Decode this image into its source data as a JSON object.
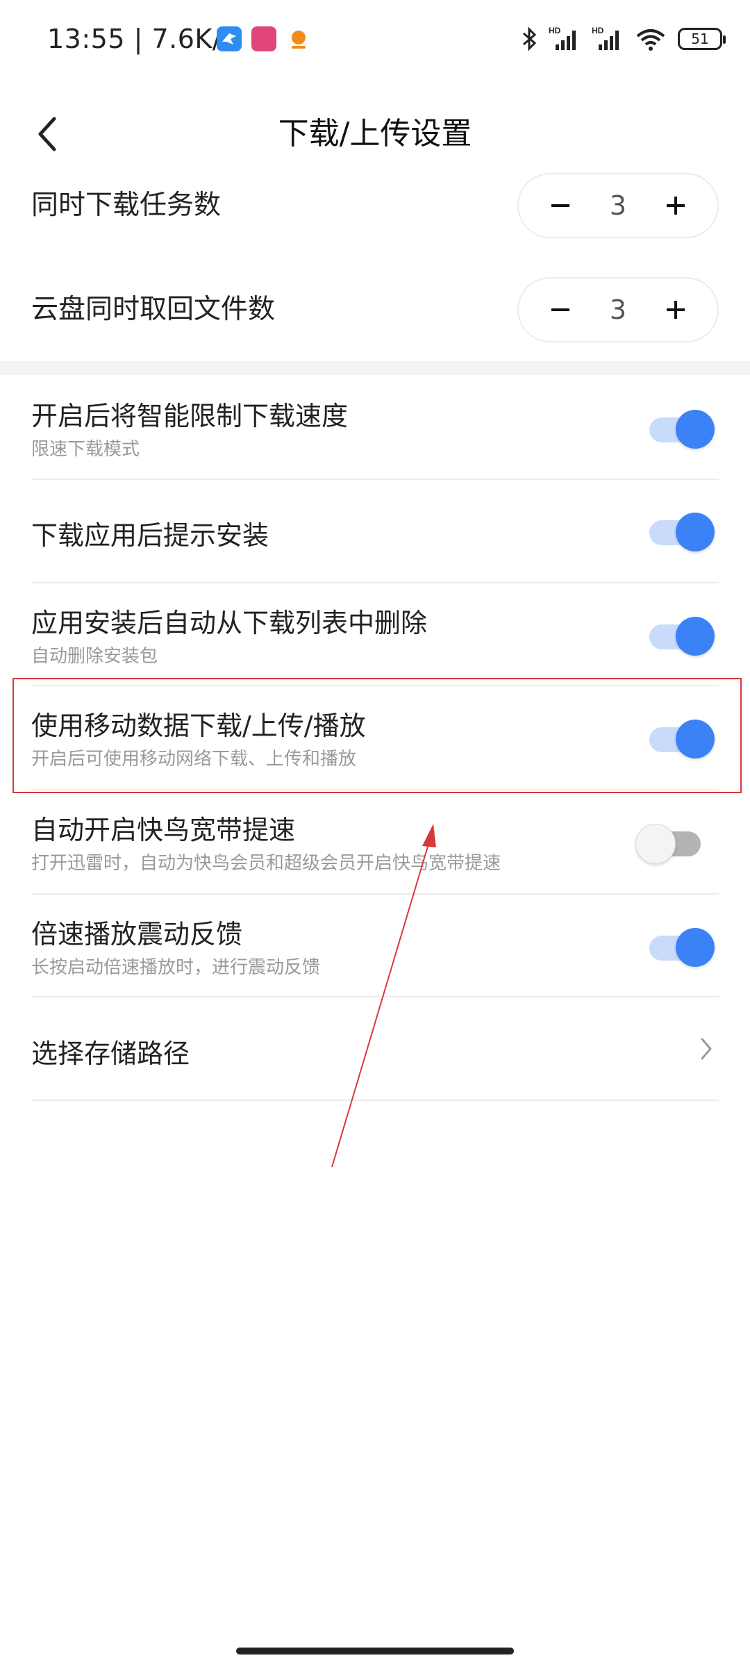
{
  "status_bar": {
    "time": "13:55 | 7.6K/s",
    "battery": "51",
    "icons": [
      "app-bird-icon",
      "app-store-icon",
      "app-orange-icon",
      "bluetooth-icon",
      "signal-hd-icon",
      "signal-hd-icon",
      "wifi-icon",
      "battery-icon"
    ]
  },
  "header": {
    "title": "下载/上传设置",
    "back_icon": "chevron-left-icon"
  },
  "steppers": [
    {
      "label": "同时下载任务数",
      "value": "3",
      "minus": "−",
      "plus": "+"
    },
    {
      "label": "云盘同时取回文件数",
      "value": "3",
      "minus": "−",
      "plus": "+"
    }
  ],
  "settings": [
    {
      "title": "开启后将智能限制下载速度",
      "subtitle": "限速下载模式",
      "on": true
    },
    {
      "title": "下载应用后提示安装",
      "subtitle": "",
      "on": true
    },
    {
      "title": "应用安装后自动从下载列表中删除",
      "subtitle": "自动删除安装包",
      "on": true
    },
    {
      "title": "使用移动数据下载/上传/播放",
      "subtitle": "开启后可使用移动网络下载、上传和播放",
      "on": true
    },
    {
      "title": "自动开启快鸟宽带提速",
      "subtitle": "打开迅雷时，自动为快鸟会员和超级会员开启快鸟宽带提速",
      "on": false
    },
    {
      "title": "倍速播放震动反馈",
      "subtitle": "长按启动倍速播放时，进行震动反馈",
      "on": true
    }
  ],
  "storage": {
    "title": "选择存储路径",
    "icon": "chevron-right-icon"
  },
  "colors": {
    "accent": "#3b82f6",
    "accent_track": "#c9dbfb",
    "annotation": "#d9373c"
  }
}
